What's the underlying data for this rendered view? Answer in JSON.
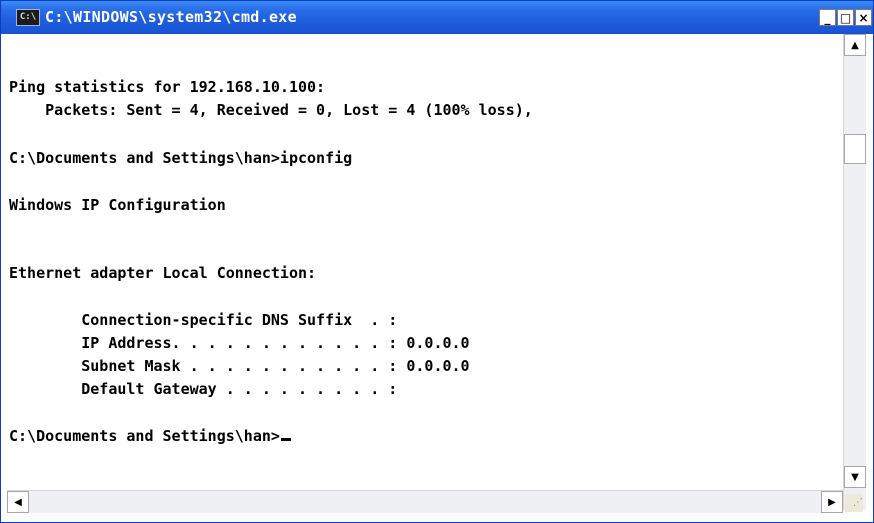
{
  "window": {
    "title": "C:\\WINDOWS\\system32\\cmd.exe",
    "icon": "cmd-icon",
    "controls": {
      "minimize": "_",
      "maximize": "□",
      "close": "×"
    }
  },
  "console": {
    "lines": [
      "Ping statistics for 192.168.10.100:",
      "    Packets: Sent = 4, Received = 0, Lost = 4 (100% loss),",
      "C:\\Documents and Settings\\han>ipconfig",
      "Windows IP Configuration",
      "Ethernet adapter Local Connection:",
      "        Connection-specific DNS Suffix  . :",
      "        IP Address. . . . . . . . . . . . : 0.0.0.0",
      "        Subnet Mask . . . . . . . . . . . : 0.0.0.0",
      "        Default Gateway . . . . . . . . . :",
      "C:\\Documents and Settings\\han>"
    ]
  },
  "scrollbars": {
    "up_arrow": "▲",
    "down_arrow": "▼",
    "left_arrow": "◀",
    "right_arrow": "▶",
    "grip": "⋰"
  },
  "colors": {
    "titlebar": "#1f5fde",
    "console_bg": "#ffffff",
    "console_text": "#000000"
  }
}
